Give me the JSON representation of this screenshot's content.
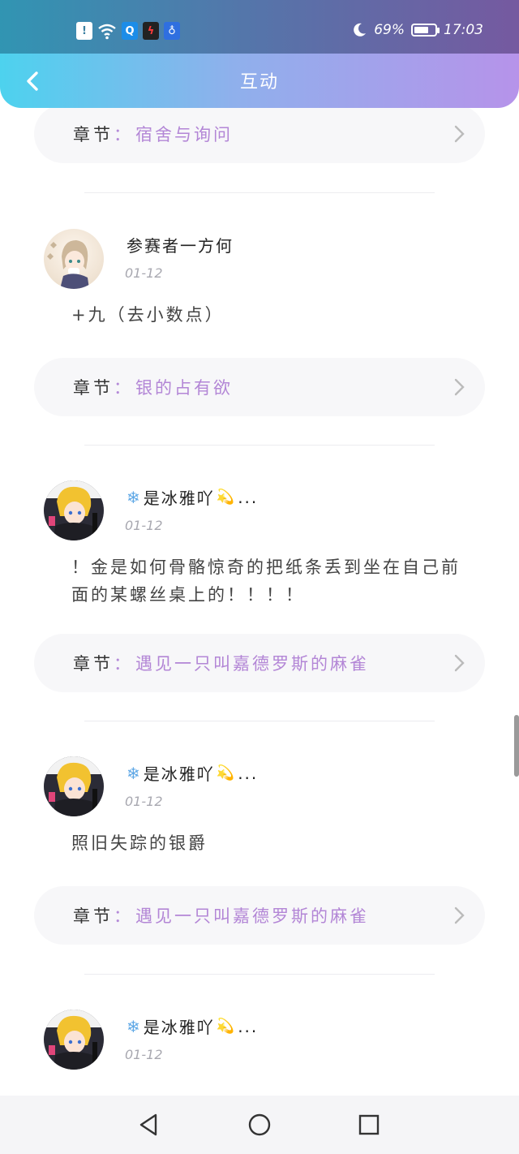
{
  "status_bar": {
    "icons": [
      "alert-icon",
      "wifi-icon",
      "search-app-icon",
      "game-app-icon",
      "bulb-app-icon"
    ],
    "battery_percent": "69%",
    "battery_level": 0.69,
    "time": "17:03"
  },
  "header": {
    "title": "互动"
  },
  "chapter_key": "章节",
  "chapter_colon": "：",
  "items": [
    {
      "chapter": "宿舍与询问"
    },
    {
      "username": "参赛者一方何",
      "date": "01-12",
      "comment": "+九（去小数点）",
      "chapter": "银的占有欲"
    },
    {
      "username": "是冰雅吖",
      "suffix": "...",
      "date": "01-12",
      "comment": "！金是如何骨骼惊奇的把纸条丢到坐在自己前面的某螺丝桌上的！！！！",
      "chapter": "遇见一只叫嘉德罗斯的麻雀"
    },
    {
      "username": "是冰雅吖",
      "suffix": "...",
      "date": "01-12",
      "comment": "照旧失踪的银爵",
      "chapter": "遇见一只叫嘉德罗斯的麻雀"
    },
    {
      "username": "是冰雅吖",
      "suffix": "...",
      "date": "01-12"
    }
  ],
  "colors": {
    "accent": "#b386d6",
    "gradient_start": "#4dd2ee",
    "gradient_end": "#b693ea"
  }
}
